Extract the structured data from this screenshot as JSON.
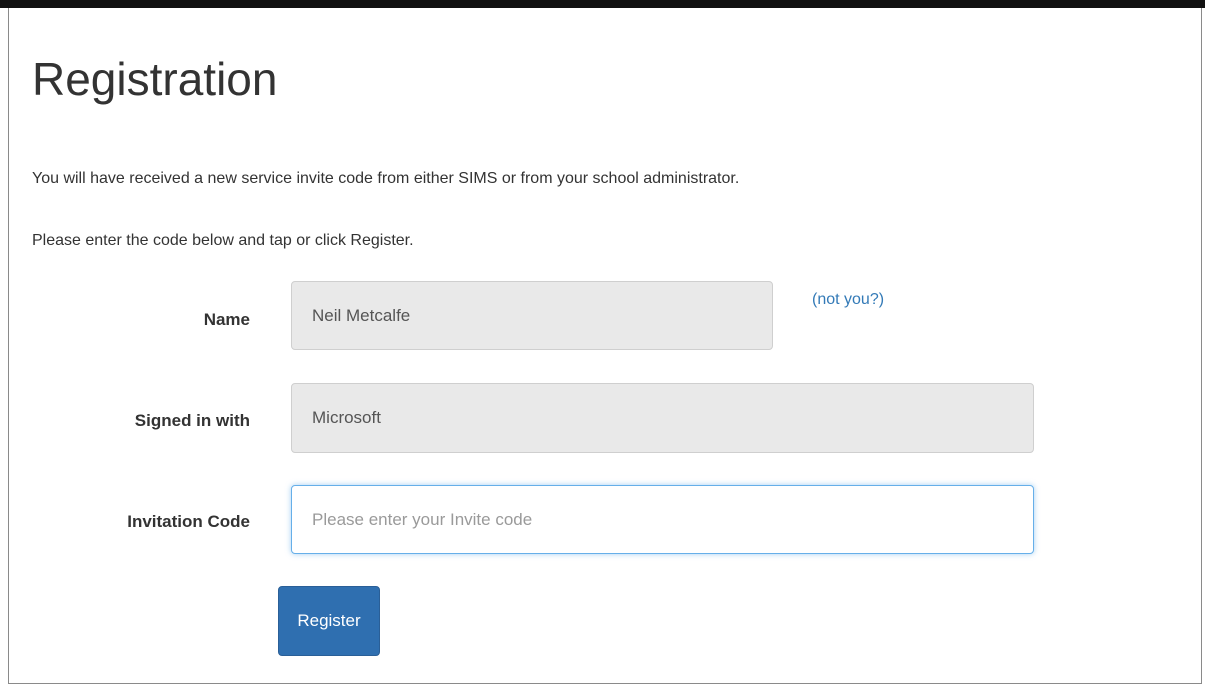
{
  "page": {
    "title": "Registration",
    "intro_line1": "You will have received a new service invite code from either SIMS or from your school administrator.",
    "intro_line2": "Please enter the code below and tap or click Register."
  },
  "form": {
    "name": {
      "label": "Name",
      "value": "Neil Metcalfe",
      "not_you_link": "(not you?)"
    },
    "signed_in_with": {
      "label": "Signed in with",
      "value": "Microsoft"
    },
    "invitation_code": {
      "label": "Invitation Code",
      "value": "",
      "placeholder": "Please enter your Invite code"
    },
    "register_button": "Register"
  },
  "colors": {
    "accent": "#2f6fb0",
    "link": "#337ab7",
    "readonly_bg": "#e9e9e9",
    "focus_border": "#66afe9"
  }
}
